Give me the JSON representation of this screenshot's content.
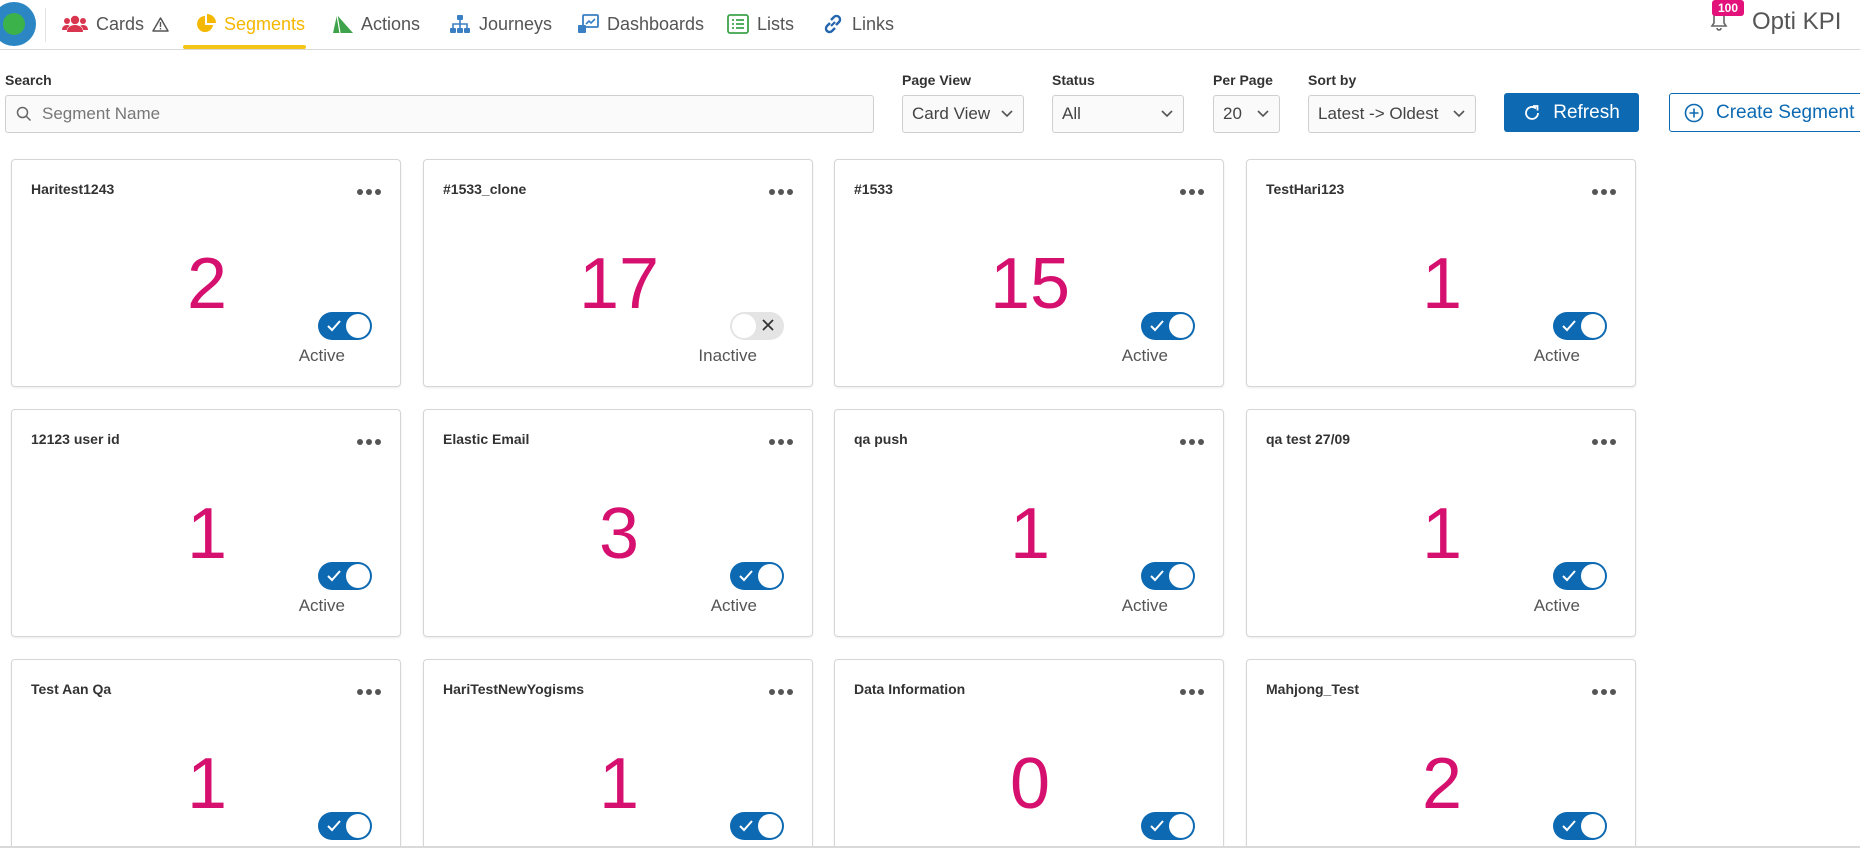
{
  "nav": {
    "items": [
      {
        "label": "Cards",
        "icon": "users-icon"
      },
      {
        "label": "Segments",
        "icon": "pie-chart-icon"
      },
      {
        "label": "Actions",
        "icon": "paper-plane-icon"
      },
      {
        "label": "Journeys",
        "icon": "sitemap-icon"
      },
      {
        "label": "Dashboards",
        "icon": "chart-icon"
      },
      {
        "label": "Lists",
        "icon": "list-icon"
      },
      {
        "label": "Links",
        "icon": "link-icon"
      }
    ],
    "active": "Segments",
    "notification_count": "100",
    "brand": "Opti KPI"
  },
  "filters": {
    "search_label": "Search",
    "search_placeholder": "Segment Name",
    "page_view_label": "Page View",
    "page_view_value": "Card View",
    "status_label": "Status",
    "status_value": "All",
    "per_page_label": "Per Page",
    "per_page_value": "20",
    "sort_label": "Sort by",
    "sort_value": "Latest -> Oldest",
    "refresh_label": "Refresh",
    "create_label": "Create Segment"
  },
  "segments": [
    {
      "name": "Haritest1243",
      "count": "2",
      "status": "Active"
    },
    {
      "name": "#1533_clone",
      "count": "17",
      "status": "Inactive"
    },
    {
      "name": "#1533",
      "count": "15",
      "status": "Active"
    },
    {
      "name": "TestHari123",
      "count": "1",
      "status": "Active"
    },
    {
      "name": "12123 user id",
      "count": "1",
      "status": "Active"
    },
    {
      "name": "Elastic Email",
      "count": "3",
      "status": "Active"
    },
    {
      "name": "qa push",
      "count": "1",
      "status": "Active"
    },
    {
      "name": "qa test 27/09",
      "count": "1",
      "status": "Active"
    },
    {
      "name": "Test Aan Qa",
      "count": "1",
      "status": "Active"
    },
    {
      "name": "HariTestNewYogisms",
      "count": "1",
      "status": "Active"
    },
    {
      "name": "Data Information",
      "count": "0",
      "status": "Active"
    },
    {
      "name": "Mahjong_Test",
      "count": "2",
      "status": "Active"
    }
  ],
  "colors": {
    "accent": "#f5b800",
    "primary": "#0d6ab2",
    "count": "#d6106f",
    "badge": "#e3127a"
  }
}
